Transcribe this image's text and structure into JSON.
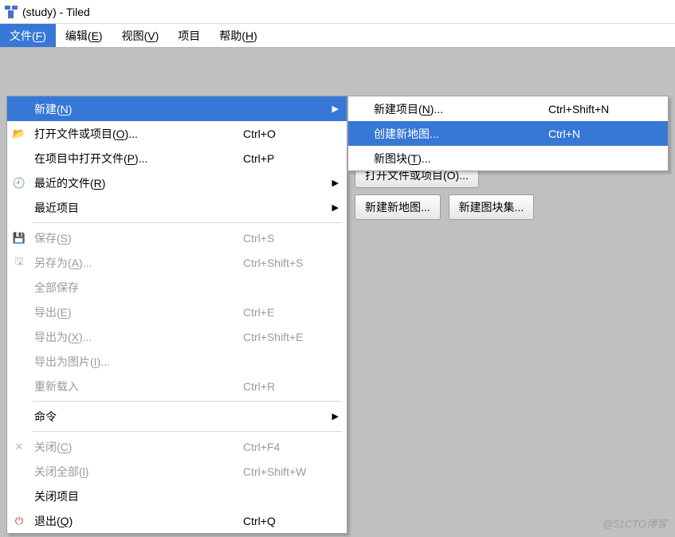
{
  "window": {
    "title": "(study) - Tiled"
  },
  "menubar": {
    "file": {
      "label": "文件(F)",
      "hotkey": "F"
    },
    "edit": {
      "label": "编辑(E)",
      "hotkey": "E"
    },
    "view": {
      "label": "视图(V)",
      "hotkey": "V"
    },
    "project": {
      "label": "项目"
    },
    "help": {
      "label": "帮助(H)",
      "hotkey": "H"
    }
  },
  "file_menu": {
    "new": {
      "label": "新建(N)",
      "hotkey": "N",
      "submenu": true
    },
    "open": {
      "label": "打开文件或项目(O)...",
      "hotkey": "O",
      "shortcut": "Ctrl+O",
      "icon": "folder-open-icon"
    },
    "open_in_project": {
      "label": "在项目中打开文件(P)...",
      "hotkey": "P",
      "shortcut": "Ctrl+P"
    },
    "recent_files": {
      "label": "最近的文件(R)",
      "hotkey": "R",
      "submenu": true,
      "icon": "clock-icon"
    },
    "recent_projects": {
      "label": "最近项目",
      "submenu": true
    },
    "save": {
      "label": "保存(S)",
      "hotkey": "S",
      "shortcut": "Ctrl+S",
      "disabled": true,
      "icon": "save-icon"
    },
    "save_as": {
      "label": "另存为(A)...",
      "hotkey": "A",
      "shortcut": "Ctrl+Shift+S",
      "disabled": true,
      "icon": "save-as-icon"
    },
    "save_all": {
      "label": "全部保存",
      "disabled": true
    },
    "export": {
      "label": "导出(E)",
      "hotkey": "E",
      "shortcut": "Ctrl+E",
      "disabled": true
    },
    "export_as": {
      "label": "导出为(X)...",
      "hotkey": "X",
      "shortcut": "Ctrl+Shift+E",
      "disabled": true
    },
    "export_image": {
      "label": "导出为图片(I)...",
      "hotkey": "I",
      "disabled": true
    },
    "reload": {
      "label": "重新载入",
      "shortcut": "Ctrl+R",
      "disabled": true
    },
    "commands": {
      "label": "命令",
      "submenu": true
    },
    "close": {
      "label": "关闭(C)",
      "hotkey": "C",
      "shortcut": "Ctrl+F4",
      "disabled": true,
      "icon": "close-icon"
    },
    "close_all": {
      "label": "关闭全部(l)",
      "hotkey": "l",
      "shortcut": "Ctrl+Shift+W",
      "disabled": true
    },
    "close_project": {
      "label": "关闭项目"
    },
    "quit": {
      "label": "退出(Q)",
      "hotkey": "Q",
      "shortcut": "Ctrl+Q",
      "icon": "quit-icon"
    }
  },
  "new_submenu": {
    "new_project": {
      "label": "新建项目(N)...",
      "hotkey": "N",
      "shortcut": "Ctrl+Shift+N"
    },
    "new_map": {
      "label": "创建新地图...",
      "shortcut": "Ctrl+N",
      "highlight": true
    },
    "new_tileset": {
      "label": "新图块(T)...",
      "hotkey": "T"
    }
  },
  "welcome_buttons": {
    "open": "打开文件或项目(O)...",
    "new_map": "新建新地图...",
    "new_tileset": "新建图块集..."
  },
  "watermark": "@51CTO博客"
}
